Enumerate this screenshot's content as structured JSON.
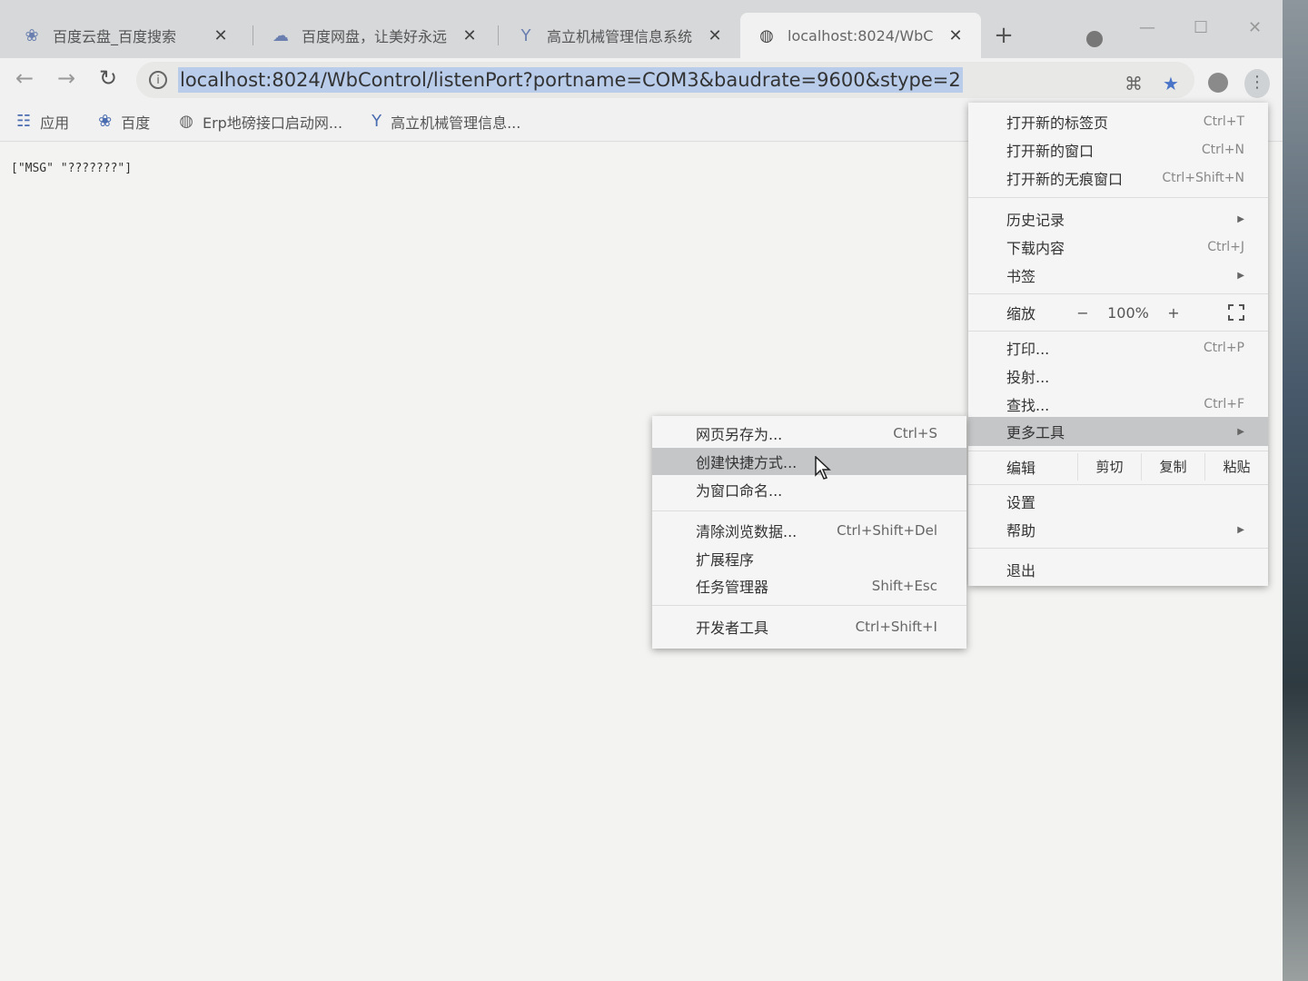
{
  "browser": {
    "tabs": [
      {
        "title": "百度云盘_百度搜索",
        "icon": "baidu-paw-icon",
        "active": false
      },
      {
        "title": "百度网盘，让美好永远",
        "icon": "baidu-netdisk-icon",
        "active": false
      },
      {
        "title": "高立机械管理信息系统",
        "icon": "y-logo-icon",
        "active": false
      },
      {
        "title": "localhost:8024/WbC",
        "icon": "globe-icon",
        "active": true
      }
    ],
    "close_glyph": "✕",
    "new_tab_glyph": "+",
    "url": "localhost:8024/WbControl/listenPort?portname=COM3&baudrate=9600&stype=2",
    "bookmarks": [
      {
        "label": "应用",
        "icon": "apps-grid-icon"
      },
      {
        "label": "百度",
        "icon": "baidu-paw-icon"
      },
      {
        "label": "Erp地磅接口启动网...",
        "icon": "globe-icon"
      },
      {
        "label": "高立机械管理信息...",
        "icon": "y-logo-icon"
      }
    ]
  },
  "page": {
    "content_text": "[\"MSG\" \"???????\"]"
  },
  "main_menu": {
    "new_tab": {
      "label": "打开新的标签页",
      "shortcut": "Ctrl+T"
    },
    "new_window": {
      "label": "打开新的窗口",
      "shortcut": "Ctrl+N"
    },
    "incognito": {
      "label": "打开新的无痕窗口",
      "shortcut": "Ctrl+Shift+N"
    },
    "history": {
      "label": "历史记录"
    },
    "downloads": {
      "label": "下载内容",
      "shortcut": "Ctrl+J"
    },
    "bookmarks": {
      "label": "书签"
    },
    "zoom": {
      "label": "缩放",
      "minus": "−",
      "value": "100%",
      "plus": "+"
    },
    "print": {
      "label": "打印...",
      "shortcut": "Ctrl+P"
    },
    "cast": {
      "label": "投射..."
    },
    "find": {
      "label": "查找...",
      "shortcut": "Ctrl+F"
    },
    "more_tools": {
      "label": "更多工具"
    },
    "edit": {
      "label": "编辑",
      "cut": "剪切",
      "copy": "复制",
      "paste": "粘贴"
    },
    "settings": {
      "label": "设置"
    },
    "help": {
      "label": "帮助"
    },
    "exit": {
      "label": "退出"
    }
  },
  "sub_menu": {
    "save_as": {
      "label": "网页另存为...",
      "shortcut": "Ctrl+S"
    },
    "create_shortcut": {
      "label": "创建快捷方式..."
    },
    "name_window": {
      "label": "为窗口命名..."
    },
    "clear_data": {
      "label": "清除浏览数据...",
      "shortcut": "Ctrl+Shift+Del"
    },
    "extensions": {
      "label": "扩展程序"
    },
    "task_manager": {
      "label": "任务管理器",
      "shortcut": "Shift+Esc"
    },
    "devtools": {
      "label": "开发者工具",
      "shortcut": "Ctrl+Shift+I"
    }
  }
}
